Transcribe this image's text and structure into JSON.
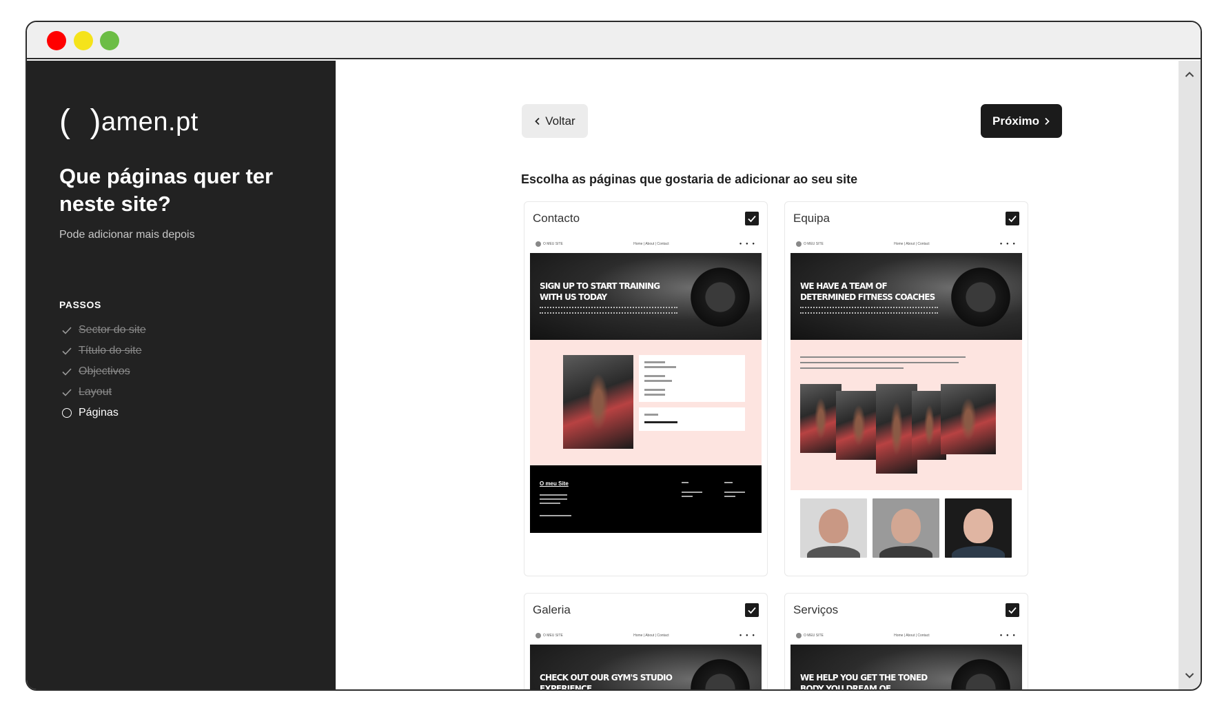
{
  "window": {
    "controls": [
      "close",
      "minimize",
      "maximize"
    ]
  },
  "sidebar": {
    "logo": {
      "bracket_open": "(",
      "bracket_close": ")",
      "text": "amen.pt"
    },
    "headline": "Que páginas quer ter neste site?",
    "subtitle": "Pode adicionar mais depois",
    "steps_title": "PASSOS",
    "steps": [
      {
        "label": "Sector do site",
        "state": "done"
      },
      {
        "label": "Título do site",
        "state": "done"
      },
      {
        "label": "Objectivos",
        "state": "done"
      },
      {
        "label": "Layout",
        "state": "done"
      },
      {
        "label": "Páginas",
        "state": "current"
      }
    ]
  },
  "main": {
    "back_label": "Voltar",
    "next_label": "Próximo",
    "instruction": "Escolha as páginas que gostaria de adicionar ao seu site",
    "cards": [
      {
        "title": "Contacto",
        "checked": true,
        "preview": {
          "brand": "O MEU SITE",
          "nav": "Home | About | Contact",
          "hero_heading": "Sign up to start training with us today",
          "footer_name": "O meu Site"
        }
      },
      {
        "title": "Equipa",
        "checked": true,
        "preview": {
          "brand": "O MEU SITE",
          "nav": "Home | About | Contact",
          "hero_heading": "We have a team of determined fitness coaches"
        }
      },
      {
        "title": "Galeria",
        "checked": true,
        "preview": {
          "brand": "O MEU SITE",
          "nav": "Home | About | Contact",
          "hero_heading": "Check out our gym's studio experience"
        }
      },
      {
        "title": "Serviços",
        "checked": true,
        "preview": {
          "brand": "O MEU SITE",
          "nav": "Home | About | Contact",
          "hero_heading": "We help you get the toned body you dream of"
        }
      }
    ]
  },
  "colors": {
    "sidebar_bg": "#222222",
    "accent_dark": "#1b1b1b",
    "preview_pink": "#fde4e0"
  }
}
